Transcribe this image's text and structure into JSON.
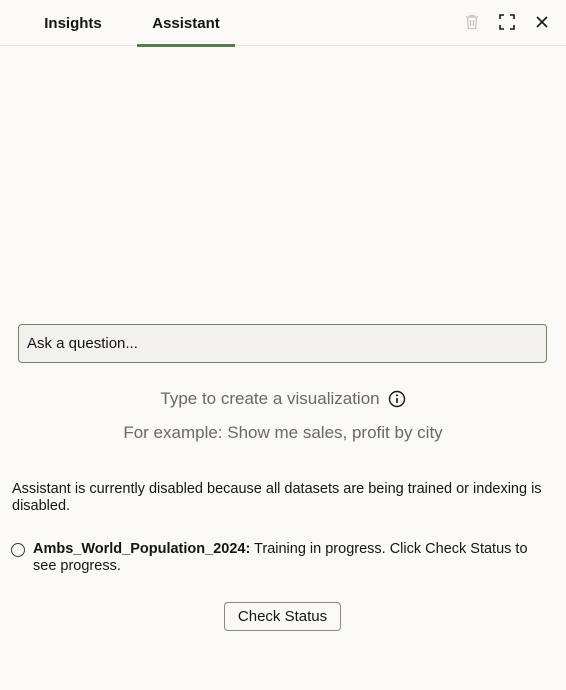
{
  "tabs": [
    {
      "label": "Insights",
      "active": false
    },
    {
      "label": "Assistant",
      "active": true
    }
  ],
  "toolbar": {
    "icons": [
      "trash-icon",
      "fullscreen-icon",
      "close-icon"
    ]
  },
  "question": {
    "placeholder": "Ask a question...",
    "value": ""
  },
  "hints": {
    "line1": "Type to create a visualization",
    "line2": "For example: Show me sales, profit by city"
  },
  "status": {
    "message": "Assistant is currently disabled because all datasets are being trained or indexing is disabled.",
    "dataset_name": "Ambs_World_Population_2024:",
    "dataset_status": " Training in progress. Click Check Status to see progress."
  },
  "check_status_label": "Check Status",
  "colors": {
    "accent": "#5a7a4f",
    "input_border": "#6f8a58",
    "muted_text": "#6b6864",
    "background": "#fbf9f8"
  }
}
